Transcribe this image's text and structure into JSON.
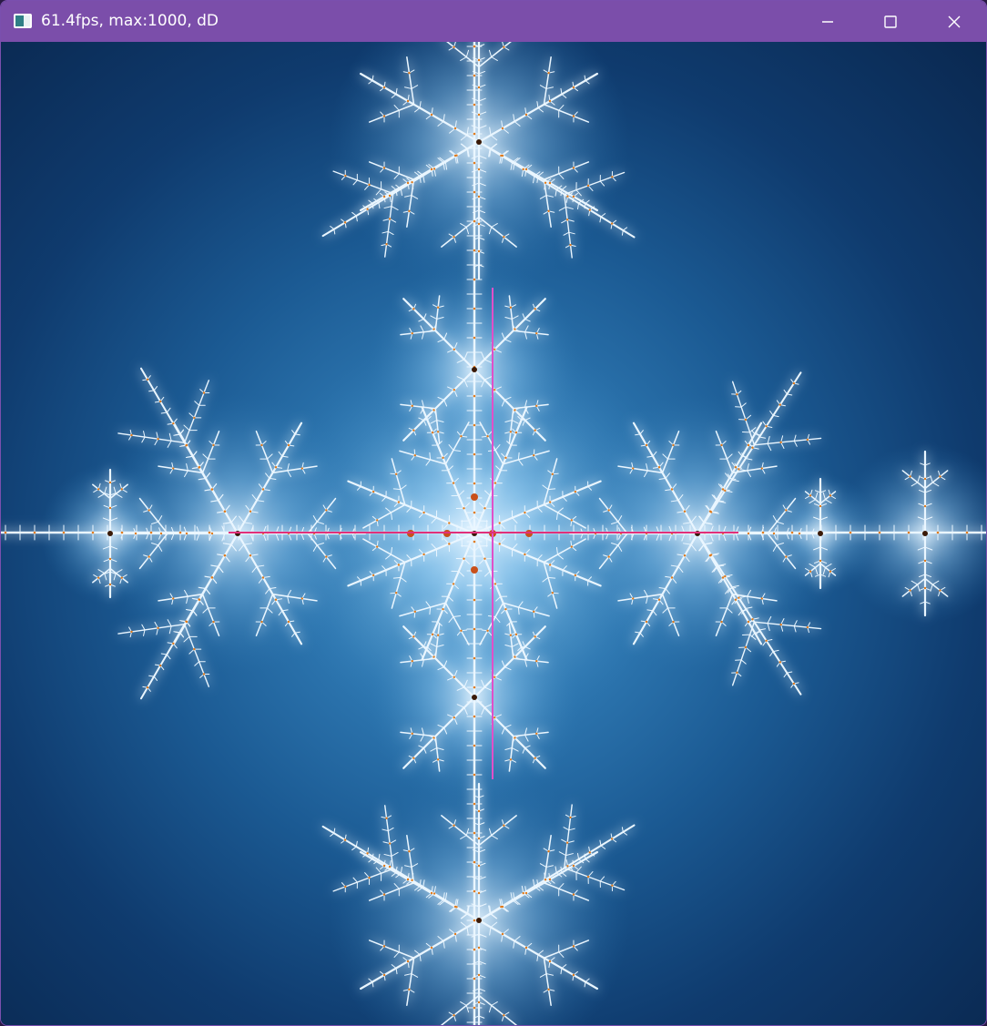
{
  "window": {
    "title": "61.4fps, max:1000, dD",
    "icon": "app-window-icon",
    "controls": {
      "minimize": "minimize-icon",
      "maximize": "maximize-icon",
      "close": "close-icon"
    }
  },
  "colors": {
    "titlebar": "#7b4eaa",
    "canvas_dark": "#0a2850",
    "canvas_light": "#5aa6d6",
    "fractal_glow": "#eaf6ff",
    "fractal_core": "#e07a1a",
    "crosshair": "#e050c8"
  }
}
